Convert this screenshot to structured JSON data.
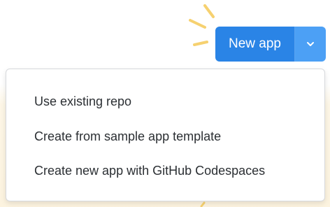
{
  "header": {
    "new_app_label": "New app",
    "toggle_icon": "chevron-down-icon"
  },
  "menu": {
    "items": [
      {
        "label": "Use existing repo"
      },
      {
        "label": "Create from sample app template"
      },
      {
        "label": "Create new app with GitHub Codespaces"
      }
    ]
  },
  "colors": {
    "primary": "#2a84e6",
    "primary_light": "#4ca0f5",
    "menu_text": "#2b2f33",
    "accent_yellow": "#f6d170",
    "background_sand": "#fcf3df"
  }
}
